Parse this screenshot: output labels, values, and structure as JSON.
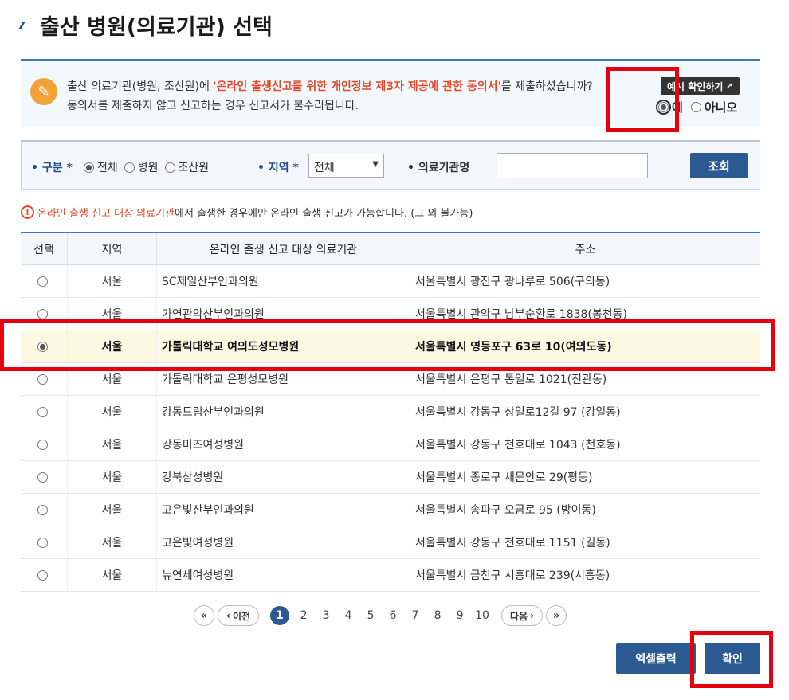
{
  "page": {
    "title": "출산 병원(의료기관) 선택"
  },
  "consent": {
    "line1_prefix": "출산 의료기관(병원, 조산원)에 ",
    "line1_highlight": "'온라인 출생신고를 위한 개인정보 제3자 제공에 관한 동의서'",
    "line1_suffix": "를 제출하셨습니까?",
    "line2": "동의서를 제출하지 않고 신고하는 경우 신고서가 불수리됩니다.",
    "example_button": "예시 확인하기",
    "yes_label": "예",
    "no_label": "아니오",
    "selected": "예"
  },
  "search": {
    "type_label": "구분",
    "type_options": [
      "전체",
      "병원",
      "조산원"
    ],
    "type_selected": "전체",
    "region_label": "지역",
    "region_value": "전체",
    "name_label": "의료기관명",
    "name_value": "",
    "search_button": "조회"
  },
  "notice": {
    "highlight": "온라인 출생 신고 대상 의료기관",
    "text": "에서 출생한 경우에만 온라인 출생 신고가 가능합니다. (그 외 불가능)"
  },
  "table": {
    "headers": [
      "선택",
      "지역",
      "온라인 출생 신고 대상 의료기관",
      "주소"
    ],
    "rows": [
      {
        "region": "서울",
        "name": "SC제일산부인과의원",
        "address": "서울특별시 광진구 광나루로 506(구의동)",
        "selected": false
      },
      {
        "region": "서울",
        "name": "가연관악산부인과의원",
        "address": "서울특별시 관악구 남부순환로 1838(봉천동)",
        "selected": false
      },
      {
        "region": "서울",
        "name": "가톨릭대학교 여의도성모병원",
        "address": "서울특별시 영등포구 63로 10(여의도동)",
        "selected": true
      },
      {
        "region": "서울",
        "name": "가톨릭대학교 은평성모병원",
        "address": "서울특별시 은평구 통일로 1021(진관동)",
        "selected": false
      },
      {
        "region": "서울",
        "name": "강동드림산부인과의원",
        "address": "서울특별시 강동구 상일로12길 97 (강일동)",
        "selected": false
      },
      {
        "region": "서울",
        "name": "강동미즈여성병원",
        "address": "서울특별시 강동구 천호대로 1043 (천호동)",
        "selected": false
      },
      {
        "region": "서울",
        "name": "강북삼성병원",
        "address": "서울특별시 종로구 새문안로 29(평동)",
        "selected": false
      },
      {
        "region": "서울",
        "name": "고은빛산부인과의원",
        "address": "서울특별시 송파구 오금로 95 (방이동)",
        "selected": false
      },
      {
        "region": "서울",
        "name": "고은빛여성병원",
        "address": "서울특별시 강동구 천호대로 1151 (길동)",
        "selected": false
      },
      {
        "region": "서울",
        "name": "뉴연세여성병원",
        "address": "서울특별시 금천구 시흥대로 239(시흥동)",
        "selected": false
      }
    ]
  },
  "pagination": {
    "first_icon": "first-page-icon",
    "prev_label": "이전",
    "pages": [
      "1",
      "2",
      "3",
      "4",
      "5",
      "6",
      "7",
      "8",
      "9",
      "10"
    ],
    "current": "1",
    "next_label": "다음",
    "last_icon": "last-page-icon"
  },
  "buttons": {
    "excel": "엑셀출력",
    "confirm": "확인"
  },
  "colors": {
    "primary": "#2b5a92",
    "highlight": "#e24a2b",
    "annotation": "#e3000f",
    "selected_row": "#fdf8e1"
  }
}
